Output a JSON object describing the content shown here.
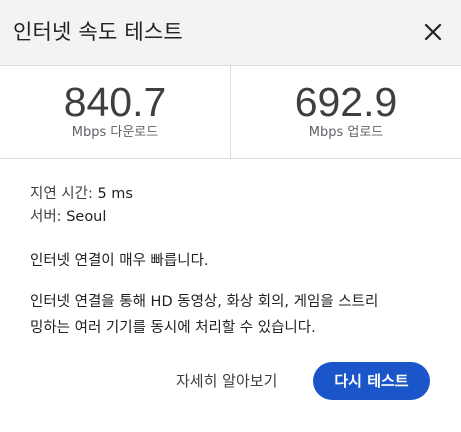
{
  "dialog": {
    "title": "인터넷 속도 테스트",
    "close_icon": "close-icon"
  },
  "speeds": {
    "download": {
      "value": "840.7",
      "label": "Mbps 다운로드"
    },
    "upload": {
      "value": "692.9",
      "label": "Mbps 업로드"
    }
  },
  "details": {
    "latency_key": "지연 시간:",
    "latency_value": "5 ms",
    "server_key": "서버:",
    "server_value": "Seoul"
  },
  "summary": "인터넷 연결이 매우 빠릅니다.",
  "description": {
    "line1": "인터넷 연결을 통해 HD 동영상, 화상 회의, 게임을 스트리",
    "line2": "밍하는 여러 기기를 동시에 처리할 수 있습니다."
  },
  "actions": {
    "learn_more": "자세히 알아보기",
    "retest": "다시 테스트"
  },
  "colors": {
    "accent": "#1a56c9",
    "header_bg": "#f3f3f3",
    "divider": "#dadce0"
  }
}
